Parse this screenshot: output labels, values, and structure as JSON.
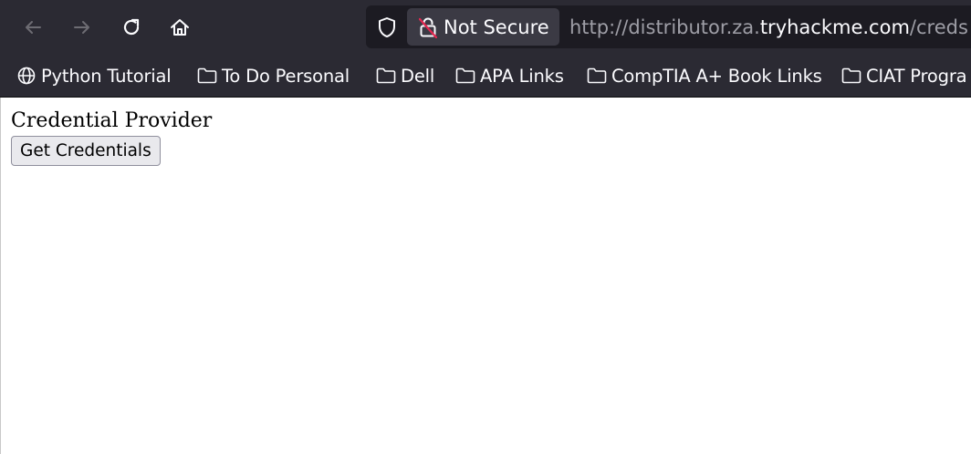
{
  "toolbar": {
    "back_icon": "arrow-left-icon",
    "forward_icon": "arrow-right-icon",
    "reload_icon": "reload-icon",
    "home_icon": "home-icon",
    "security_label": "Not Secure",
    "url_scheme": "http://",
    "url_subdomain": "distributor.za.",
    "url_host": "tryhackme.com",
    "url_path": "/creds"
  },
  "bookmarks": {
    "items": [
      {
        "label": "Python Tutorial",
        "icon": "globe-icon"
      },
      {
        "label": "To Do Personal",
        "icon": "folder-icon"
      },
      {
        "label": "Dell",
        "icon": "folder-icon"
      },
      {
        "label": "APA Links",
        "icon": "folder-icon"
      },
      {
        "label": "CompTIA A+ Book Links",
        "icon": "folder-icon"
      },
      {
        "label": "CIAT Progra",
        "icon": "folder-icon"
      }
    ]
  },
  "page": {
    "title": "Credential Provider",
    "button_label": "Get Credentials"
  },
  "colors": {
    "toolbar_bg": "#2b2a33",
    "urlbar_bg": "#1c1b22",
    "chip_bg": "#3b3a44",
    "insecure_red": "#e22850"
  }
}
